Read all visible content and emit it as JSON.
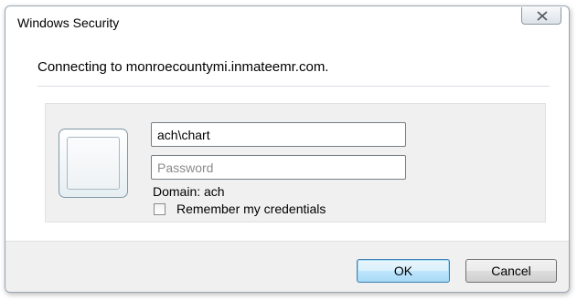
{
  "window": {
    "title": "Windows Security",
    "close_icon": "close-x-icon"
  },
  "message": "Connecting to monroecountymi.inmateemr.com.",
  "credentials": {
    "tile_icon": "user-tile-icon",
    "username_value": "ach\\chart",
    "password_placeholder": "Password",
    "domain_text": "Domain: ach",
    "remember_label": "Remember my credentials",
    "remember_checked": false
  },
  "buttons": {
    "ok_label": "OK",
    "cancel_label": "Cancel"
  }
}
